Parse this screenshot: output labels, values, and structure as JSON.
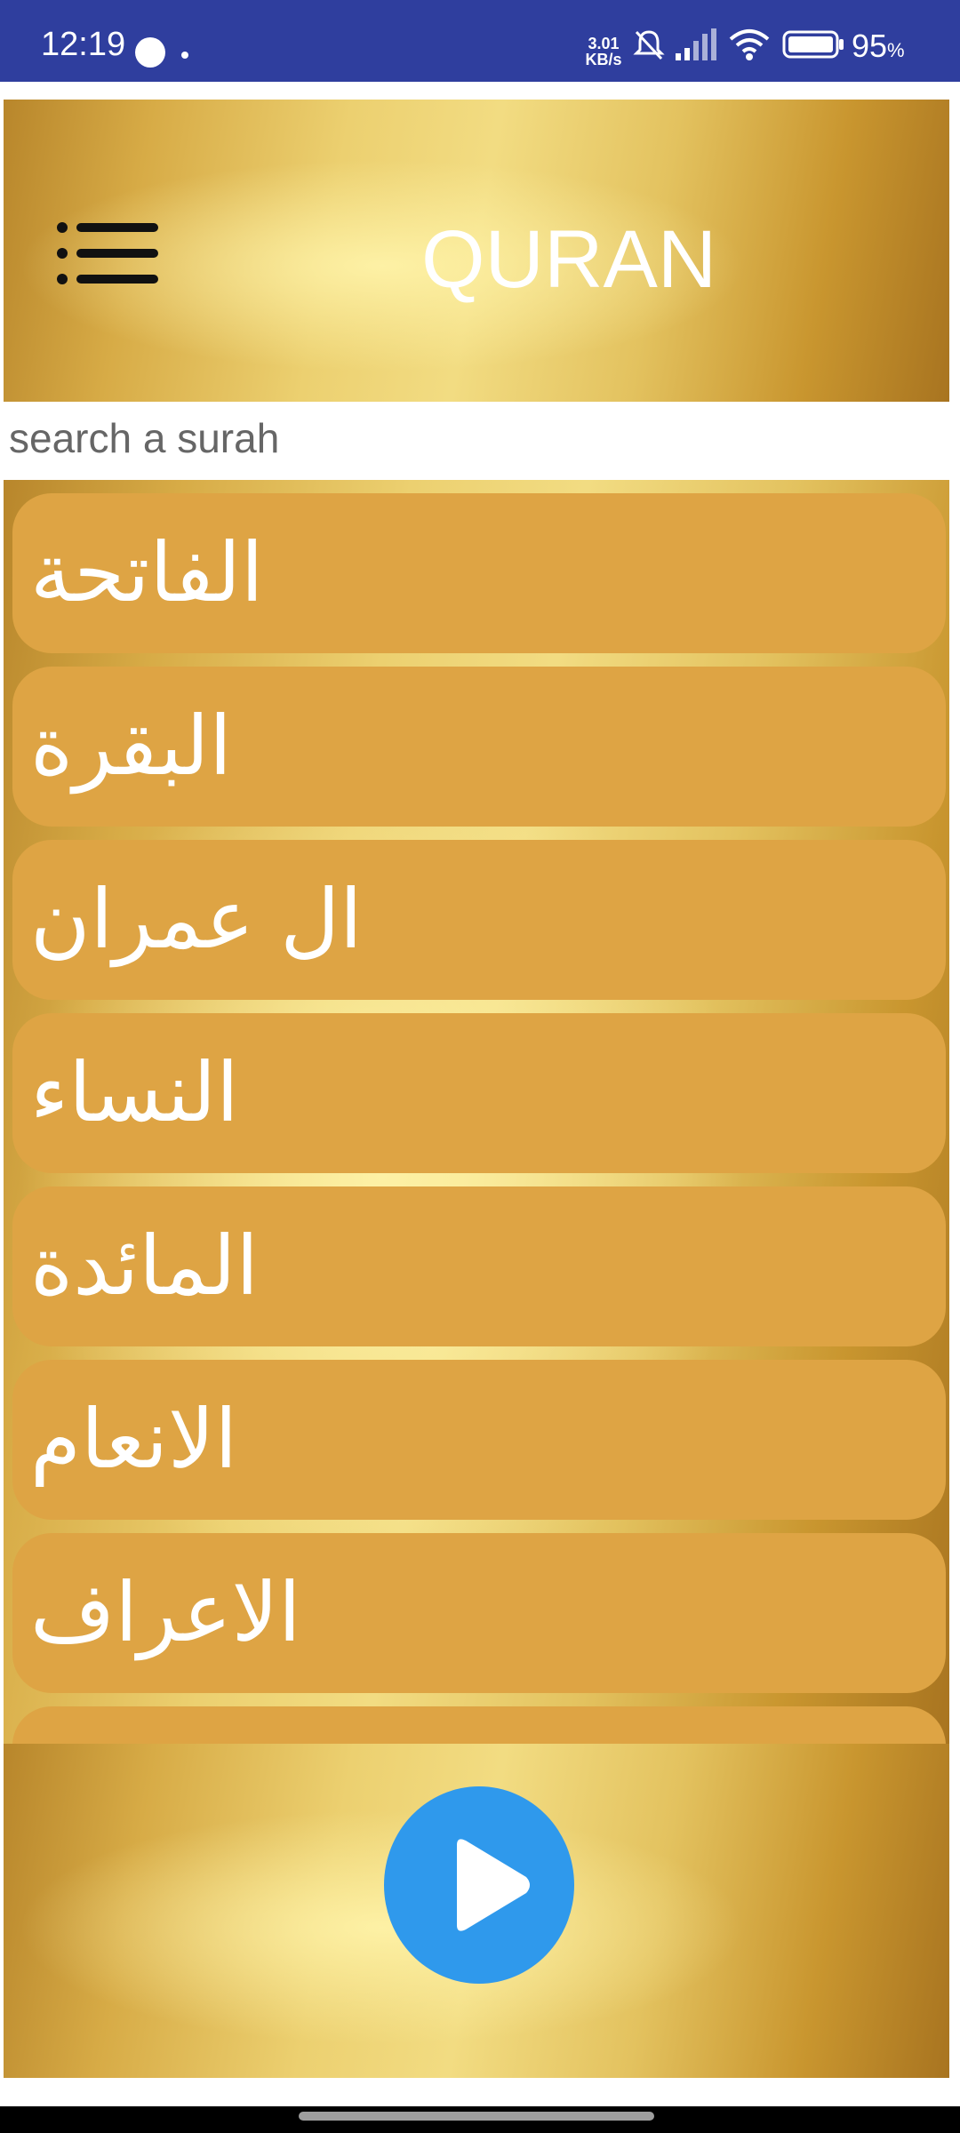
{
  "status_bar": {
    "time": "12:19",
    "net_speed_value": "3.01",
    "net_speed_unit": "KB/s",
    "battery_percent": "95",
    "battery_unit": "%",
    "icons": [
      "record-dot-icon",
      "notification-dot-icon",
      "mute-bell-icon",
      "signal-icon",
      "wifi-icon",
      "battery-icon"
    ]
  },
  "header": {
    "title": "QURAN",
    "menu_icon": "hamburger-menu-icon"
  },
  "search": {
    "placeholder": "search a surah"
  },
  "surah_list": [
    {
      "name": "الفاتحة"
    },
    {
      "name": "البقرة"
    },
    {
      "name": "ال عمران"
    },
    {
      "name": "النساء"
    },
    {
      "name": "المائدة"
    },
    {
      "name": "الانعام"
    },
    {
      "name": "الاعراف"
    }
  ],
  "player": {
    "play_icon": "play-icon"
  },
  "colors": {
    "status_bar": "#2f3e9e",
    "list_item": "#dea444",
    "play_button": "#2f99ec",
    "text_light": "#ffffff"
  }
}
